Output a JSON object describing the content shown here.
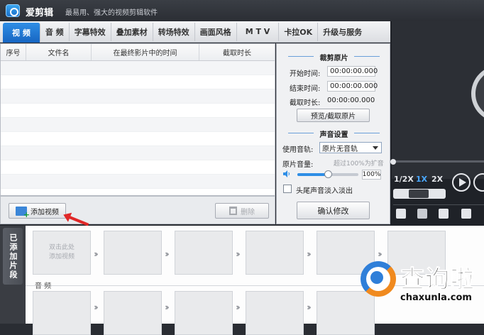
{
  "app": {
    "title": "爱剪辑",
    "slogan": "最易用、强大的视频剪辑软件"
  },
  "tabs": [
    {
      "label": "视  频"
    },
    {
      "label": "音  频"
    },
    {
      "label": "字幕特效"
    },
    {
      "label": "叠加素材"
    },
    {
      "label": "转场特效"
    },
    {
      "label": "画面风格"
    },
    {
      "label": "M T V"
    },
    {
      "label": "卡拉OK"
    },
    {
      "label": "升级与服务"
    }
  ],
  "video_list": {
    "columns": [
      "序号",
      "文件名",
      "在最终影片中的时间",
      "截取时长"
    ],
    "add_button": "添加视频",
    "delete_button": "删除"
  },
  "trim": {
    "title": "裁剪原片",
    "start_label": "开始时间:",
    "start_value": "00:00:00.000",
    "end_label": "结束时间:",
    "end_value": "00:00:00.000",
    "duration_label": "截取时长:",
    "duration_value": "00:00:00.000",
    "preview_button": "预览/截取原片"
  },
  "audio": {
    "title": "声音设置",
    "track_label": "使用音轨:",
    "track_value": "原片无音轨",
    "volume_label": "原片音量:",
    "volume_hint": "超过100%为扩音",
    "volume_value": "100%",
    "volume_level": 0.5,
    "fade_label": "头尾声音淡入淡出",
    "confirm_button": "确认修改"
  },
  "player": {
    "speeds": [
      "1/2X",
      "1X",
      "2X"
    ]
  },
  "timeline": {
    "tab_label": "已添加片段",
    "empty_hint_line1": "双击此处",
    "empty_hint_line2": "添加视频",
    "audio_label": "音 频"
  },
  "watermark": {
    "text": "查询啦",
    "url": "chaxunla.com"
  },
  "colors": {
    "accent": "#2f8ee6",
    "titlebar": "#2b2e34",
    "annotation_arrow": "#e02828"
  }
}
